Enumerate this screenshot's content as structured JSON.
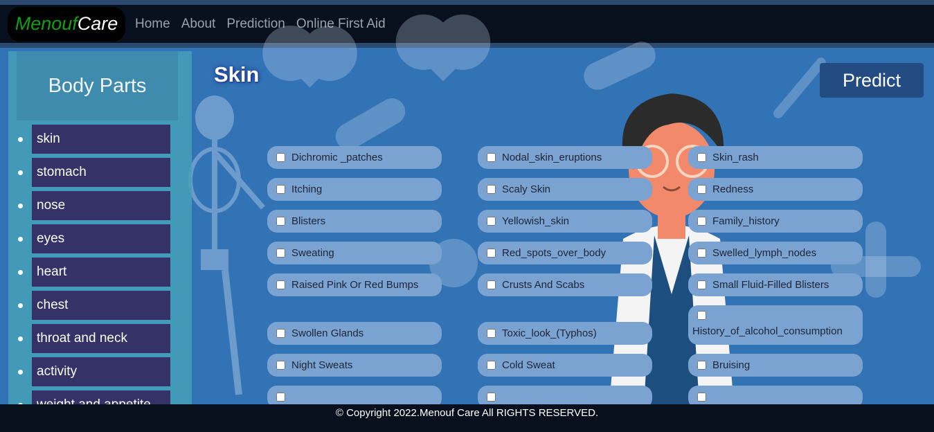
{
  "navbar": {
    "brand_part1": "Menouf",
    "brand_part2": "Care",
    "links": [
      "Home",
      "About",
      "Prediction",
      "Online First Aid"
    ]
  },
  "sidebar": {
    "title": "Body Parts",
    "items": [
      "skin",
      "stomach",
      "nose",
      "eyes",
      "heart",
      "chest",
      "throat and neck",
      "activity",
      "weight and appetite"
    ]
  },
  "main": {
    "section_title": "Skin",
    "predict_label": "Predict",
    "symptoms": {
      "col1": [
        "Dichromic _patches",
        "Itching",
        "Blisters",
        "Sweating",
        "Raised Pink Or Red Bumps",
        "Swollen Glands",
        "Night Sweats",
        ""
      ],
      "col2": [
        "Nodal_skin_eruptions",
        "Scaly Skin",
        "Yellowish_skin",
        "Red_spots_over_body",
        "Crusts And Scabs",
        "Toxic_look_(Typhos)",
        "Cold Sweat",
        ""
      ],
      "col3": [
        "Skin_rash",
        "Redness",
        "Family_history",
        "Swelled_lymph_nodes",
        "Small Fluid-Filled Blisters",
        "History_of_alcohol_consumption",
        "Bruising",
        ""
      ]
    }
  },
  "footer": {
    "text": "© Copyright 2022.Menouf Care All RIGHTS RESERVED."
  }
}
